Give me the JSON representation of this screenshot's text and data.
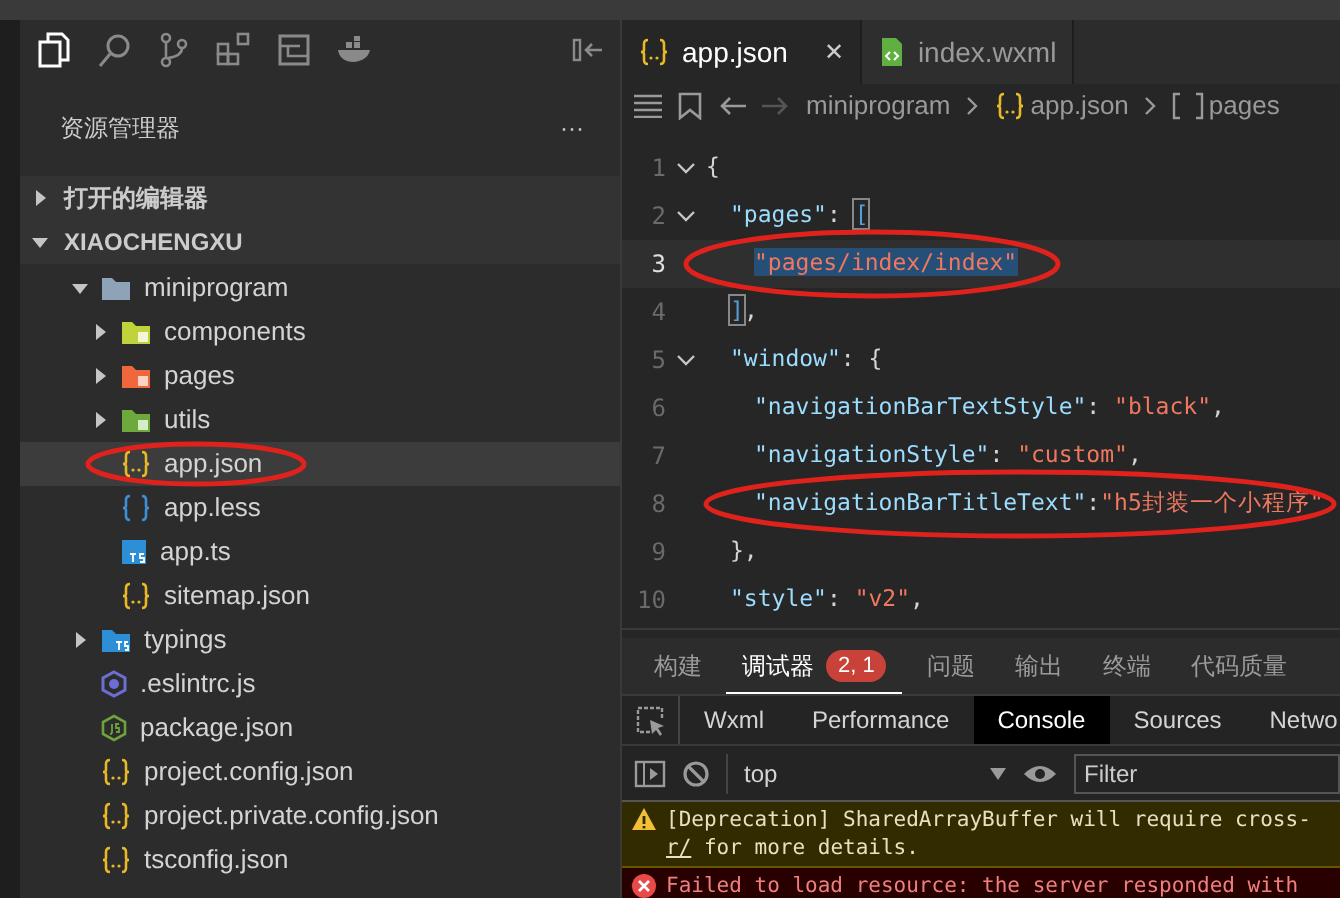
{
  "sidebar": {
    "title": "资源管理器",
    "more": "···",
    "sections": [
      {
        "label": "打开的编辑器",
        "expanded": false
      },
      {
        "label": "XIAOCHENGXU",
        "expanded": true
      }
    ],
    "tree": [
      {
        "label": "miniprogram",
        "kind": "folder",
        "expanded": true,
        "selected": false,
        "circled": false,
        "children": [
          {
            "label": "components",
            "kind": "folder-components",
            "expanded": false,
            "selected": false,
            "circled": false
          },
          {
            "label": "pages",
            "kind": "folder-pages",
            "expanded": false,
            "selected": false,
            "circled": false
          },
          {
            "label": "utils",
            "kind": "folder-utils",
            "expanded": false,
            "selected": false,
            "circled": false
          },
          {
            "label": "app.json",
            "kind": "json",
            "selected": true,
            "circled": true
          },
          {
            "label": "app.less",
            "kind": "less",
            "selected": false,
            "circled": false
          },
          {
            "label": "app.ts",
            "kind": "ts",
            "selected": false,
            "circled": false
          },
          {
            "label": "sitemap.json",
            "kind": "json",
            "selected": false,
            "circled": false
          }
        ]
      },
      {
        "label": "typings",
        "kind": "folder-ts",
        "expanded": false,
        "selected": false,
        "circled": false
      },
      {
        "label": ".eslintrc.js",
        "kind": "eslint",
        "selected": false,
        "circled": false
      },
      {
        "label": "package.json",
        "kind": "node",
        "selected": false,
        "circled": false
      },
      {
        "label": "project.config.json",
        "kind": "json",
        "selected": false,
        "circled": false
      },
      {
        "label": "project.private.config.json",
        "kind": "json",
        "selected": false,
        "circled": false
      },
      {
        "label": "tsconfig.json",
        "kind": "json",
        "selected": false,
        "circled": false
      }
    ]
  },
  "editor": {
    "tabs": [
      {
        "label": "app.json",
        "kind": "json",
        "selected": true,
        "close": "✕"
      },
      {
        "label": "index.wxml",
        "kind": "wxml",
        "selected": false
      }
    ],
    "breadcrumb": [
      {
        "label": "miniprogram",
        "kind": "plain"
      },
      {
        "label": "app.json",
        "kind": "json"
      },
      {
        "label": "pages",
        "kind": "array"
      }
    ],
    "lines": [
      {
        "number": "1",
        "fold": true,
        "current": false,
        "circled": false,
        "tokens": [
          {
            "kind": "punct",
            "text": "{"
          }
        ]
      },
      {
        "number": "2",
        "fold": true,
        "current": false,
        "circled": false,
        "tokens": [
          {
            "kind": "key",
            "text": "\"pages\""
          },
          {
            "kind": "punct",
            "text": ": "
          },
          {
            "kind": "open-match",
            "text": "["
          }
        ]
      },
      {
        "number": "3",
        "fold": false,
        "current": true,
        "circled": true,
        "tokens": [
          {
            "kind": "string-selected",
            "text": "\"pages/index/index\""
          }
        ]
      },
      {
        "number": "4",
        "fold": false,
        "current": false,
        "circled": false,
        "tokens": [
          {
            "kind": "close-match",
            "text": "]"
          },
          {
            "kind": "punct",
            "text": ","
          }
        ]
      },
      {
        "number": "5",
        "fold": true,
        "current": false,
        "circled": false,
        "tokens": [
          {
            "kind": "key",
            "text": "\"window\""
          },
          {
            "kind": "punct",
            "text": ": {"
          }
        ]
      },
      {
        "number": "6",
        "fold": false,
        "current": false,
        "circled": false,
        "tokens": [
          {
            "kind": "key",
            "text": "\"navigationBarTextStyle\""
          },
          {
            "kind": "punct",
            "text": ": "
          },
          {
            "kind": "string",
            "text": "\"black\""
          },
          {
            "kind": "punct",
            "text": ","
          }
        ]
      },
      {
        "number": "7",
        "fold": false,
        "current": false,
        "circled": false,
        "tokens": [
          {
            "kind": "key",
            "text": "\"navigationStyle\""
          },
          {
            "kind": "punct",
            "text": ": "
          },
          {
            "kind": "string",
            "text": "\"custom\""
          },
          {
            "kind": "punct",
            "text": ","
          }
        ]
      },
      {
        "number": "8",
        "fold": false,
        "current": false,
        "circled": true,
        "tokens": [
          {
            "kind": "key",
            "text": "\"navigationBarTitleText\""
          },
          {
            "kind": "punct",
            "text": ":"
          },
          {
            "kind": "string",
            "text": "\"h5封装一个小程序\""
          }
        ]
      },
      {
        "number": "9",
        "fold": false,
        "current": false,
        "circled": false,
        "tokens": [
          {
            "kind": "punct",
            "text": "},"
          }
        ]
      },
      {
        "number": "10",
        "fold": false,
        "current": false,
        "circled": false,
        "tokens": [
          {
            "kind": "key",
            "text": "\"style\""
          },
          {
            "kind": "punct",
            "text": ": "
          },
          {
            "kind": "string",
            "text": "\"v2\""
          },
          {
            "kind": "punct",
            "text": ","
          }
        ]
      }
    ]
  },
  "panel": {
    "tabs": [
      {
        "label": "构建",
        "selected": false
      },
      {
        "label": "调试器",
        "selected": true,
        "badge": "2, 1"
      },
      {
        "label": "问题",
        "selected": false
      },
      {
        "label": "输出",
        "selected": false
      },
      {
        "label": "终端",
        "selected": false
      },
      {
        "label": "代码质量",
        "selected": false
      }
    ],
    "devtools_tabs": [
      {
        "label": "Wxml",
        "selected": false
      },
      {
        "label": "Performance",
        "selected": false
      },
      {
        "label": "Console",
        "selected": true
      },
      {
        "label": "Sources",
        "selected": false
      },
      {
        "label": "Netwo",
        "selected": false
      }
    ],
    "context": "top",
    "filter": {
      "placeholder": "Filter"
    },
    "messages": [
      {
        "kind": "warning",
        "text": "[Deprecation] SharedArrayBuffer will require cross-",
        "link": "r/",
        "rest": " for more details."
      },
      {
        "kind": "error",
        "text": "Failed to load resource: the server responded with"
      }
    ]
  }
}
